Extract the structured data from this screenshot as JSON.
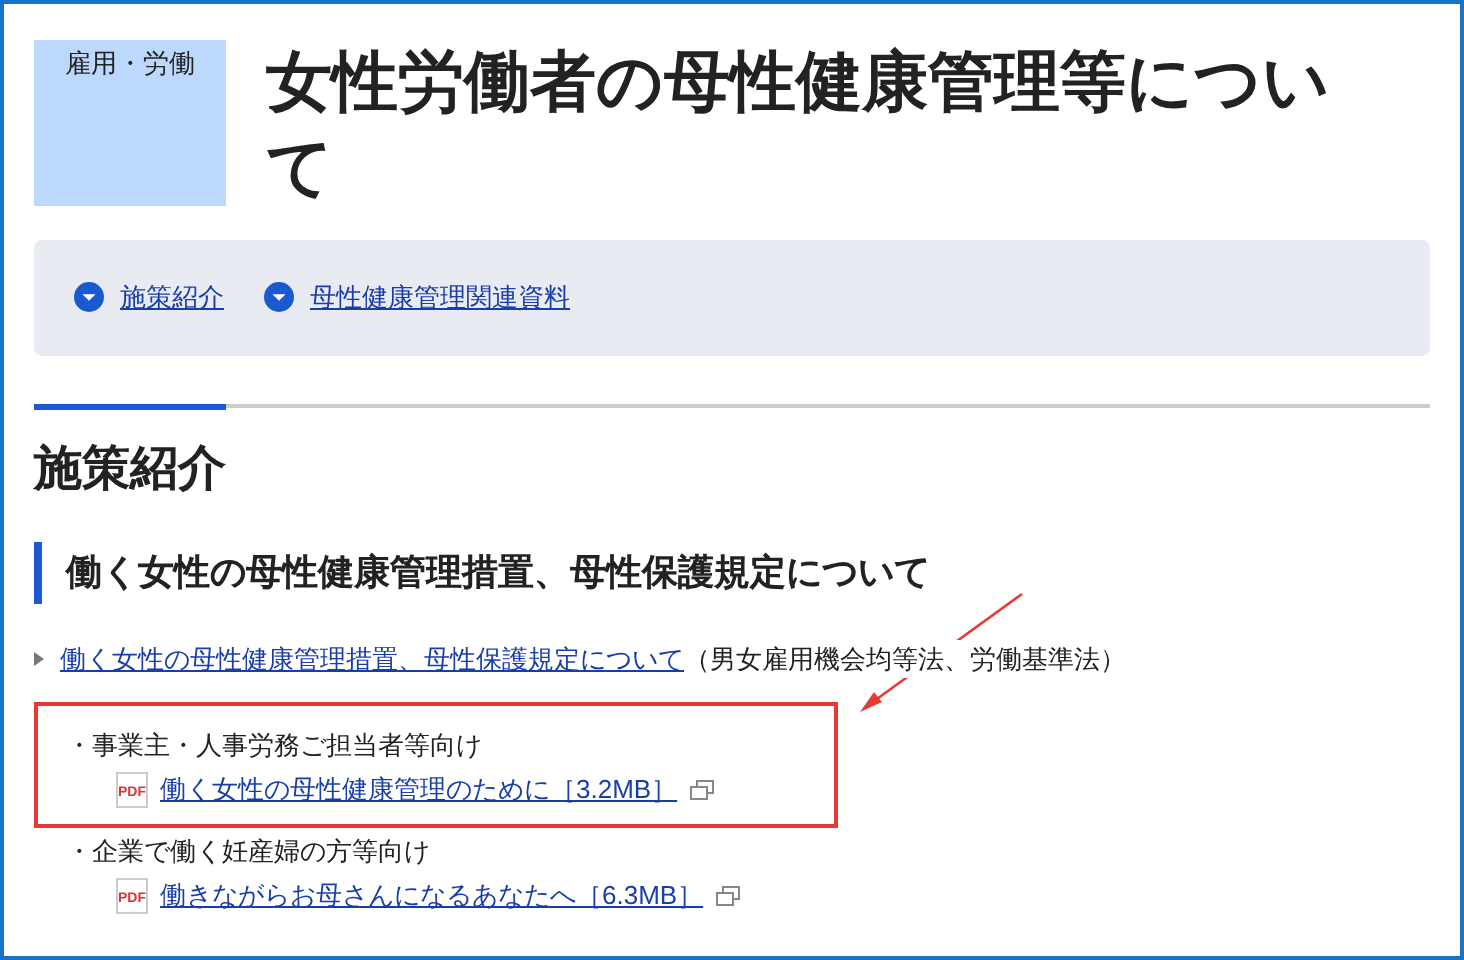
{
  "category": "雇用・労働",
  "title": "女性労働者の母性健康管理等について",
  "nav_links": [
    "施策紹介",
    "母性健康管理関連資料"
  ],
  "section_heading": "施策紹介",
  "subheading": "働く女性の母性健康管理措置、母性保護規定について",
  "lead_link": {
    "label": "働く女性の母性健康管理措置、母性保護規定について",
    "note": "（男女雇用機会均等法、労働基準法）"
  },
  "audiences": [
    {
      "label": "・事業主・人事労務ご担当者等向け",
      "highlighted": true,
      "file": {
        "type": "PDF",
        "label": "働く女性の母性健康管理のために［3.2MB］"
      }
    },
    {
      "label": "・企業で働く妊産婦の方等向け",
      "highlighted": false,
      "file": {
        "type": "PDF",
        "label": "働きながらお母さんになるあなたへ［6.3MB］"
      }
    }
  ]
}
